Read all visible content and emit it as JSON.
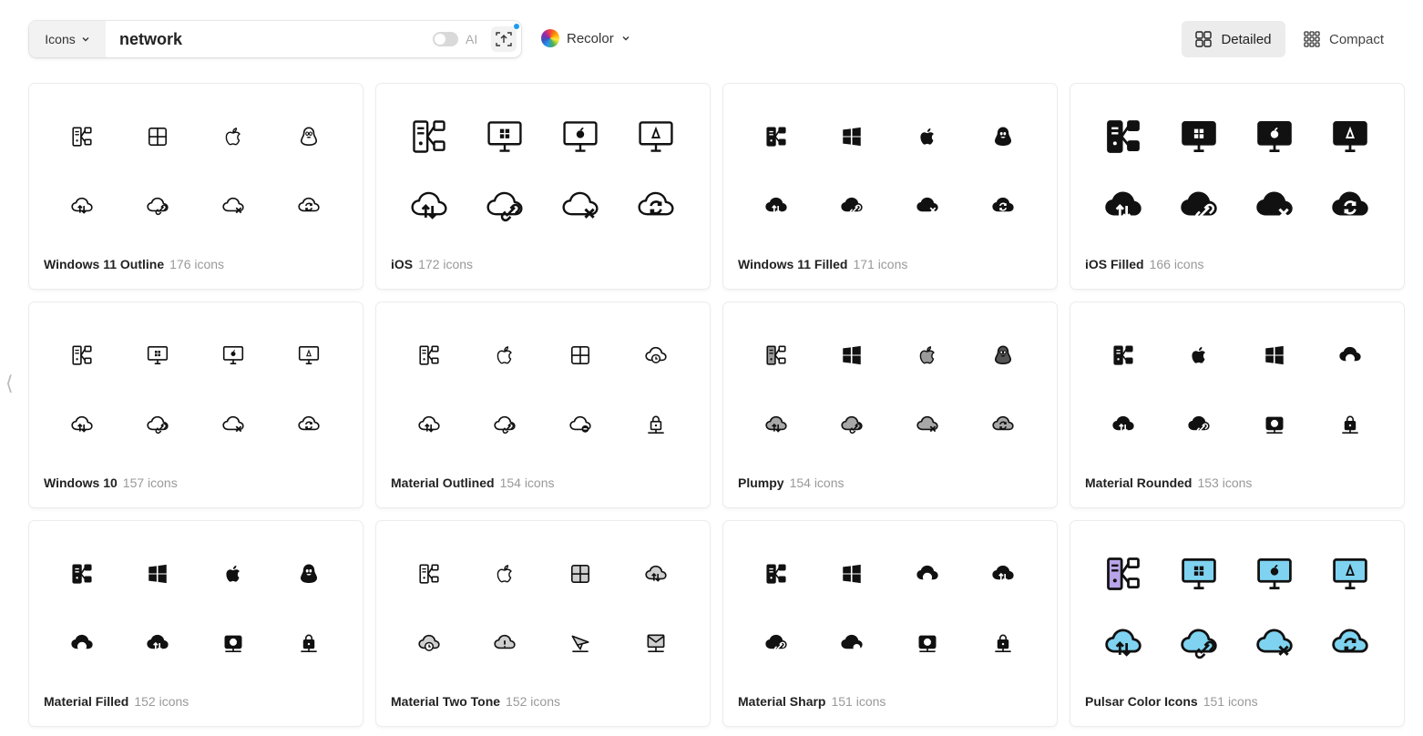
{
  "search": {
    "type_label": "Icons",
    "query": "network",
    "ai_label": "AI",
    "ai_enabled": false
  },
  "recolor": {
    "label": "Recolor"
  },
  "view": {
    "detailed_label": "Detailed",
    "compact_label": "Compact",
    "active": "Detailed"
  },
  "packs": [
    {
      "name": "Windows 11 Outline",
      "count": "176 icons",
      "style": "outline",
      "icons": [
        "server-network",
        "windows-logo",
        "apple-logo",
        "linux-tux",
        "cloud-upload-download",
        "cloud-link",
        "cloud-delete",
        "cloud-sync"
      ]
    },
    {
      "name": "iOS",
      "count": "172 icons",
      "style": "outline-large",
      "icons": [
        "server-network",
        "monitor-windows",
        "monitor-apple",
        "monitor-linux",
        "cloud-upload-download",
        "cloud-link",
        "cloud-delete",
        "cloud-sync"
      ]
    },
    {
      "name": "Windows 11 Filled",
      "count": "171 icons",
      "style": "filled",
      "icons": [
        "server-network",
        "windows-logo",
        "apple-logo",
        "linux-tux",
        "cloud-upload-download",
        "cloud-link",
        "cloud-delete",
        "cloud-sync"
      ]
    },
    {
      "name": "iOS Filled",
      "count": "166 icons",
      "style": "filled-large",
      "icons": [
        "server-network",
        "monitor-windows",
        "monitor-apple",
        "monitor-linux",
        "cloud-upload-download",
        "cloud-link",
        "cloud-delete",
        "cloud-sync"
      ]
    },
    {
      "name": "Windows 10",
      "count": "157 icons",
      "style": "outline",
      "icons": [
        "server-network",
        "monitor-windows",
        "monitor-apple",
        "monitor-linux",
        "cloud-upload-download",
        "cloud-link",
        "cloud-delete",
        "cloud-sync"
      ]
    },
    {
      "name": "Material Outlined",
      "count": "154 icons",
      "style": "outline",
      "icons": [
        "server-network",
        "apple-logo",
        "windows-logo",
        "cloud-clock",
        "cloud-upload-download",
        "cloud-link",
        "cloud-minus",
        "network-lock"
      ]
    },
    {
      "name": "Plumpy",
      "count": "154 icons",
      "style": "plumpy",
      "icons": [
        "server-network",
        "windows-logo",
        "apple-logo",
        "linux-tux",
        "cloud-upload-download",
        "cloud-link",
        "cloud-delete",
        "cloud-sync"
      ]
    },
    {
      "name": "Material Rounded",
      "count": "153 icons",
      "style": "filled",
      "icons": [
        "server-network",
        "apple-logo",
        "windows-logo",
        "cloud-clock",
        "cloud-upload-download",
        "cloud-link",
        "network-camera",
        "network-lock"
      ]
    },
    {
      "name": "Material Filled",
      "count": "152 icons",
      "style": "filled",
      "icons": [
        "server-network",
        "windows-logo",
        "apple-logo",
        "linux-tux",
        "cloud-clock",
        "cloud-upload-download",
        "network-camera",
        "network-lock"
      ]
    },
    {
      "name": "Material Two Tone",
      "count": "152 icons",
      "style": "twotone",
      "icons": [
        "server-network",
        "apple-logo",
        "windows-logo",
        "cloud-upload-download",
        "cloud-clock",
        "cloud-alert",
        "network-send",
        "network-mail"
      ]
    },
    {
      "name": "Material Sharp",
      "count": "151 icons",
      "style": "filled",
      "icons": [
        "server-network",
        "windows-logo",
        "cloud-clock",
        "cloud-upload-download",
        "cloud-link",
        "cloud-minus",
        "network-camera",
        "network-lock"
      ]
    },
    {
      "name": "Pulsar Color Icons",
      "count": "151 icons",
      "style": "color",
      "icons": [
        "server-network",
        "monitor-windows",
        "monitor-apple",
        "monitor-linux",
        "cloud-upload-download",
        "cloud-link",
        "cloud-delete",
        "cloud-sync"
      ]
    }
  ],
  "colors": {
    "accent_dot": "#1d9bf0",
    "pulsar_fill": "#7fd3f0",
    "pulsar_fill_alt": "#b8a4e8"
  }
}
